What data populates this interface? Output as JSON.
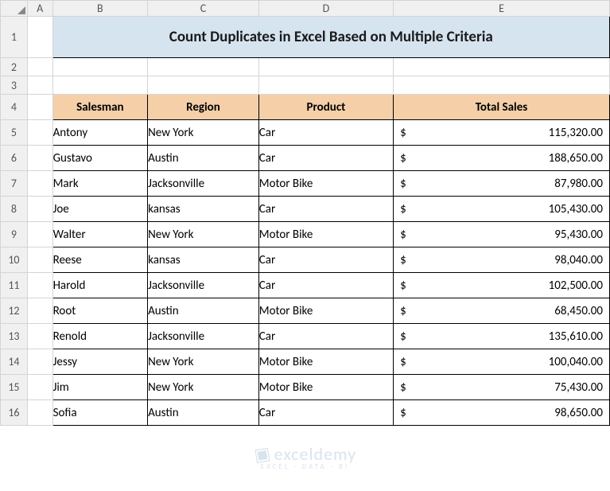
{
  "columns": [
    "A",
    "B",
    "C",
    "D",
    "E"
  ],
  "rows": [
    "1",
    "2",
    "3",
    "4",
    "5",
    "6",
    "7",
    "8",
    "9",
    "10",
    "11",
    "12",
    "13",
    "14",
    "15",
    "16"
  ],
  "title": "Count Duplicates in Excel Based on Multiple Criteria",
  "headers": {
    "salesman": "Salesman",
    "region": "Region",
    "product": "Product",
    "total_sales": "Total Sales"
  },
  "currency": "$",
  "chart_data": {
    "type": "table",
    "title": "Count Duplicates in Excel Based on Multiple Criteria",
    "columns": [
      "Salesman",
      "Region",
      "Product",
      "Total Sales"
    ],
    "rows": [
      {
        "salesman": "Antony",
        "region": "New York",
        "product": "Car",
        "total_sales": 115320.0,
        "total_sales_text": "115,320.00"
      },
      {
        "salesman": "Gustavo",
        "region": "Austin",
        "product": "Car",
        "total_sales": 188650.0,
        "total_sales_text": "188,650.00"
      },
      {
        "salesman": "Mark",
        "region": "Jacksonville",
        "product": "Motor Bike",
        "total_sales": 87980.0,
        "total_sales_text": "87,980.00"
      },
      {
        "salesman": "Joe",
        "region": "kansas",
        "product": "Car",
        "total_sales": 105430.0,
        "total_sales_text": "105,430.00"
      },
      {
        "salesman": "Walter",
        "region": "New York",
        "product": "Motor Bike",
        "total_sales": 95430.0,
        "total_sales_text": "95,430.00"
      },
      {
        "salesman": "Reese",
        "region": "kansas",
        "product": "Car",
        "total_sales": 98040.0,
        "total_sales_text": "98,040.00"
      },
      {
        "salesman": "Harold",
        "region": "Jacksonville",
        "product": "Car",
        "total_sales": 102500.0,
        "total_sales_text": "102,500.00"
      },
      {
        "salesman": "Root",
        "region": "Austin",
        "product": "Motor Bike",
        "total_sales": 68450.0,
        "total_sales_text": "68,450.00"
      },
      {
        "salesman": "Renold",
        "region": "Jacksonville",
        "product": "Car",
        "total_sales": 135610.0,
        "total_sales_text": "135,610.00"
      },
      {
        "salesman": "Jessy",
        "region": "New York",
        "product": "Motor Bike",
        "total_sales": 100040.0,
        "total_sales_text": "100,040.00"
      },
      {
        "salesman": "Jim",
        "region": "New York",
        "product": "Motor Bike",
        "total_sales": 75430.0,
        "total_sales_text": "75,430.00"
      },
      {
        "salesman": "Sofia",
        "region": "Austin",
        "product": "Car",
        "total_sales": 98650.0,
        "total_sales_text": "98,650.00"
      }
    ]
  },
  "watermark": {
    "line1": "exceldemy",
    "line2": "EXCEL · DATA · BI"
  }
}
